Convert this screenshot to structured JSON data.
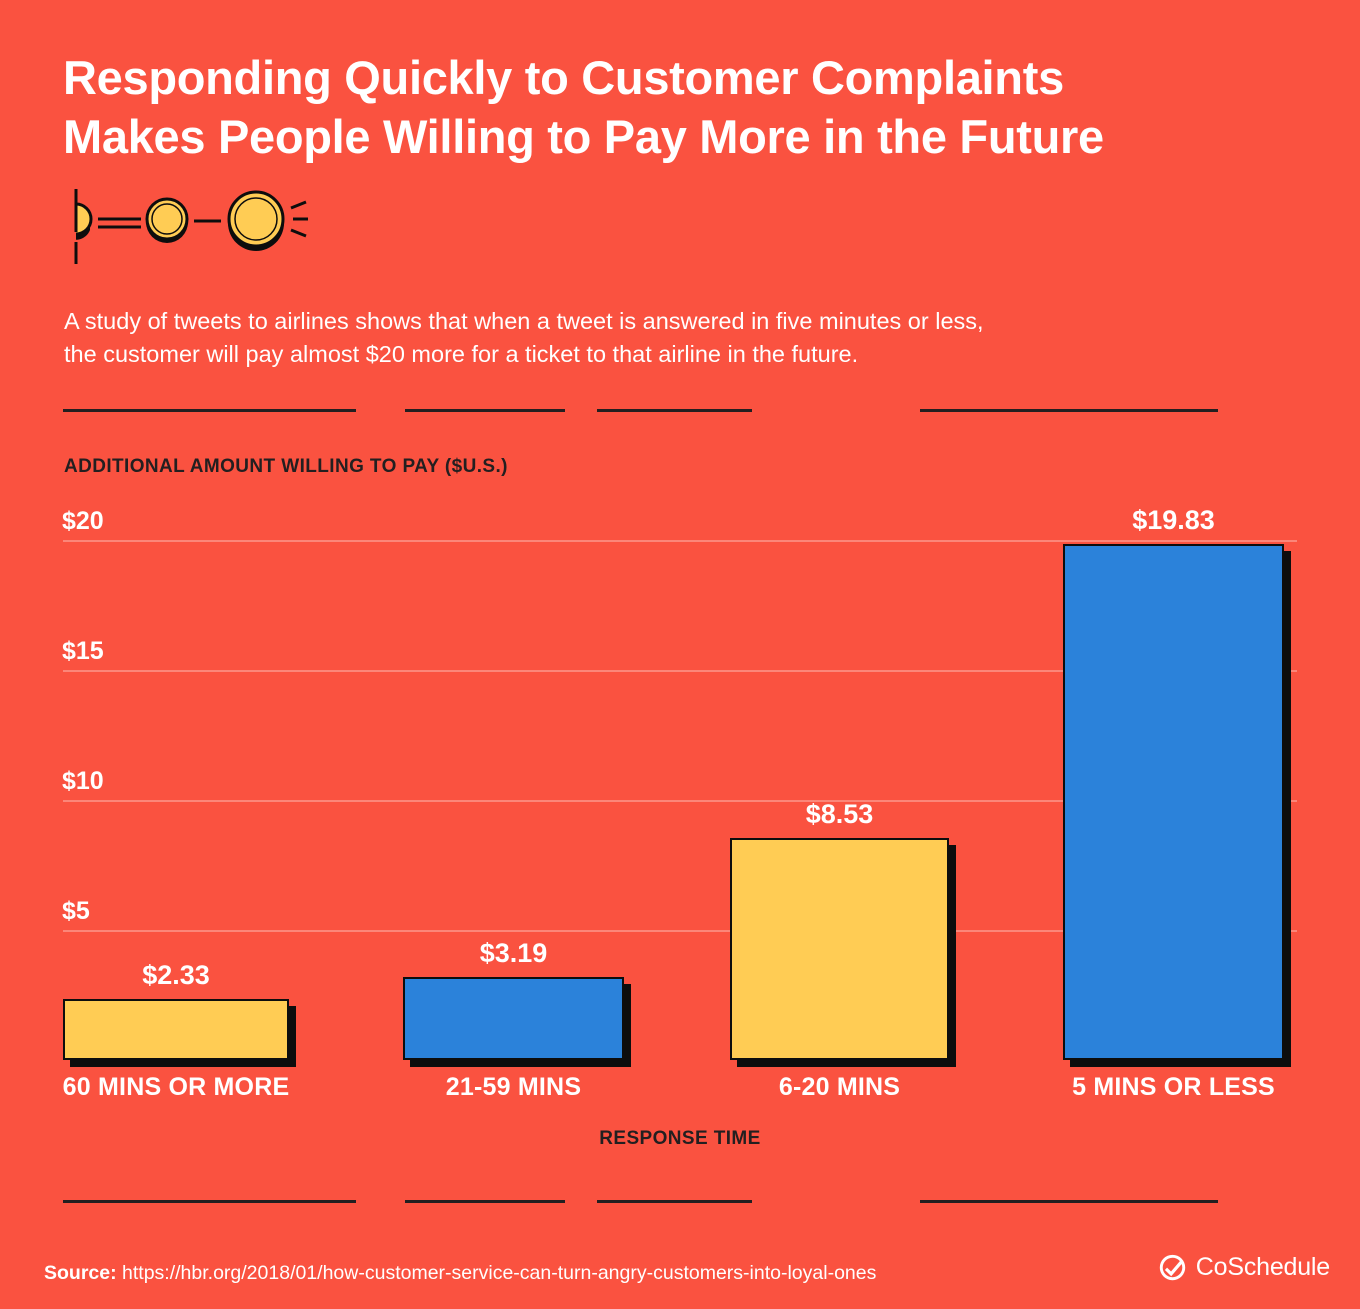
{
  "background_color": "#FA5240",
  "header": {
    "title": "Responding Quickly to Customer Complaints\nMakes People Willing to Pay More in the Future",
    "icon_name": "growing-coins-icon"
  },
  "subtitle": "A study of tweets to airlines shows that when a tweet is answered in five minutes or less,\nthe customer will pay almost $20 more for a ticket to that airline in the future.",
  "chart_data": {
    "type": "bar",
    "title": "",
    "ylabel": "ADDITIONAL AMOUNT WILLING TO PAY ($U.S.)",
    "xlabel": "RESPONSE TIME",
    "categories": [
      "60 MINS OR MORE",
      "21-59 MINS",
      "6-20 MINS",
      "5 MINS OR LESS"
    ],
    "values": [
      2.33,
      3.19,
      8.53,
      19.83
    ],
    "value_labels": [
      "$2.33",
      "$3.19",
      "$8.53",
      "$19.83"
    ],
    "bar_colors": [
      "#FFCC54",
      "#2B82DA",
      "#FFCC54",
      "#2B82DA"
    ],
    "ylim": [
      0,
      20
    ],
    "yticks": [
      20,
      15,
      10,
      5
    ],
    "ytick_labels": [
      "$20",
      "$15",
      "$10",
      "$5"
    ],
    "grid": true,
    "gridline_color": "rgba(255,255,255,0.30)",
    "legend": "none"
  },
  "footer": {
    "source_label": "Source:",
    "source_url": "https://hbr.org/2018/01/how-customer-service-can-turn-angry-customers-into-loyal-ones",
    "brand": "CoSchedule",
    "brand_icon": "check-circle-icon"
  }
}
